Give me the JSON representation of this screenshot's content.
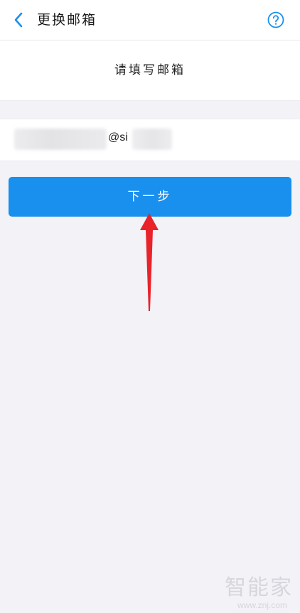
{
  "nav": {
    "title": "更换邮箱",
    "back_icon": "chevron-left-icon",
    "help_icon": "question-circle-icon"
  },
  "header": {
    "title": "请填写邮箱"
  },
  "email": {
    "visible_text": "@si"
  },
  "next_button": {
    "label": "下一步"
  },
  "watermark": {
    "text": "智能家",
    "url": "www.znj.com"
  },
  "colors": {
    "accent": "#1a90ee",
    "background": "#f2f2f7",
    "arrow": "#e8232a"
  }
}
